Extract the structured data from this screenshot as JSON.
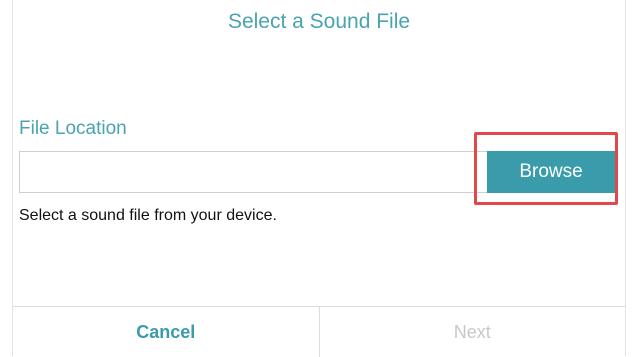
{
  "dialog": {
    "title": "Select a Sound File",
    "file_location_label": "File Location",
    "file_path_value": "",
    "browse_label": "Browse",
    "hint": "Select a sound file from your device.",
    "cancel_label": "Cancel",
    "next_label": "Next",
    "next_disabled": true
  },
  "colors": {
    "accent": "#3a9bab",
    "title_text": "#4aa3b1",
    "highlight": "#e2474b",
    "disabled_text": "#c8c8c8"
  }
}
